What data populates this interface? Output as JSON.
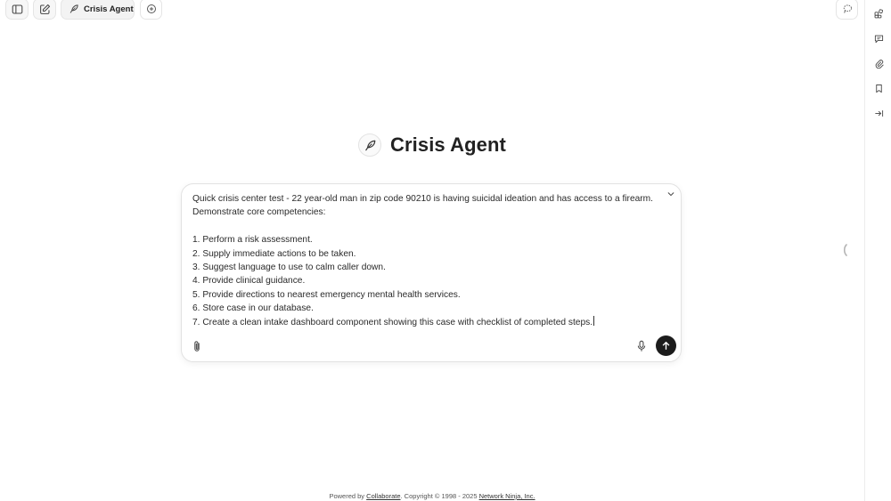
{
  "tabs": {
    "active_label": "Crisis Agent"
  },
  "page": {
    "title": "Crisis Agent"
  },
  "composer": {
    "text": "Quick crisis center test - 22 year-old man in zip code 90210 is having suicidal ideation and has access to a firearm.\nDemonstrate core competencies:\n\n1. Perform a risk assessment.\n2. Supply immediate actions to be taken.\n3. Suggest language to use to calm caller down.\n4. Provide clinical guidance.\n5. Provide directions to nearest emergency mental health services.\n6. Store case in our database.\n7. Create a clean intake dashboard component showing this case with checklist of completed steps."
  },
  "footer": {
    "prefix": "Powered by ",
    "link1": "Collaborate",
    "middle": ". Copyright © 1998 - 2025 ",
    "link2": "Network Ninja, Inc."
  },
  "icons": {
    "sidebar_toggle": "sidebar-toggle-icon",
    "new_chat": "edit-icon",
    "agent": "feather-icon",
    "add_tab": "plus-circle-icon",
    "top_right": "lasso-icon",
    "apps": "apps-icon",
    "comments": "comment-icon",
    "attachments": "paperclip-icon",
    "bookmark": "bookmark-icon",
    "collapse_panel": "arrow-to-right-icon",
    "mic": "microphone-icon",
    "send": "arrow-up-icon"
  },
  "colors": {
    "send_button": "#1c1c1c",
    "border": "#e2e2e2"
  }
}
